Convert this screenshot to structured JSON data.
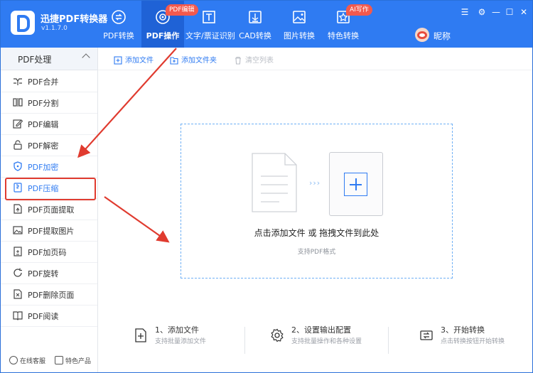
{
  "app": {
    "title": "迅捷PDF转换器",
    "version": "v1.1.7.0",
    "logo_icon": "pdf-logo-icon",
    "brand_color": "#2f7bf2"
  },
  "nav": [
    {
      "label": "PDF转换",
      "icon": "pdf-convert-icon",
      "active": false
    },
    {
      "label": "PDF操作",
      "icon": "pdf-operate-icon",
      "active": true,
      "badge": "PDF编辑"
    },
    {
      "label": "文字/票证识别",
      "icon": "text-ocr-icon",
      "active": false
    },
    {
      "label": "CAD转换",
      "icon": "cad-convert-icon",
      "active": false
    },
    {
      "label": "图片转换",
      "icon": "image-convert-icon",
      "active": false
    },
    {
      "label": "特色转换",
      "icon": "special-convert-icon",
      "active": false,
      "badge": "AI写作"
    }
  ],
  "user": {
    "nickname": "昵称"
  },
  "sidebar": {
    "header": "PDF处理",
    "items": [
      {
        "label": "PDF合并",
        "icon": "merge-icon"
      },
      {
        "label": "PDF分割",
        "icon": "split-icon"
      },
      {
        "label": "PDF编辑",
        "icon": "edit-icon"
      },
      {
        "label": "PDF解密",
        "icon": "unlock-icon"
      },
      {
        "label": "PDF加密",
        "icon": "shield-icon"
      },
      {
        "label": "PDF压缩",
        "icon": "compress-icon"
      },
      {
        "label": "PDF页面提取",
        "icon": "page-extract-icon"
      },
      {
        "label": "PDF提取图片",
        "icon": "image-extract-icon"
      },
      {
        "label": "PDF加页码",
        "icon": "page-number-icon"
      },
      {
        "label": "PDF旋转",
        "icon": "rotate-icon"
      },
      {
        "label": "PDF删除页面",
        "icon": "delete-page-icon"
      },
      {
        "label": "PDF阅读",
        "icon": "read-icon"
      }
    ],
    "footer": {
      "support": "在线客服",
      "featured": "特色产品"
    }
  },
  "toolbar": {
    "add_file": "添加文件",
    "add_folder": "添加文件夹",
    "clear_list": "清空列表"
  },
  "dropzone": {
    "title": "点击添加文件 或 拖拽文件到此处",
    "subtitle": "支持PDF格式"
  },
  "steps": [
    {
      "title": "1、添加文件",
      "desc": "支持批量添加文件",
      "icon": "add-file-icon"
    },
    {
      "title": "2、设置输出配置",
      "desc": "支持批量操作和各种设置",
      "icon": "settings-gear-icon"
    },
    {
      "title": "3、开始转换",
      "desc": "点击转换按钮开始转换",
      "icon": "start-convert-icon"
    }
  ],
  "colors": {
    "accent": "#2f7bf2",
    "badge": "#f3594d",
    "annotation": "#e03b2f"
  }
}
